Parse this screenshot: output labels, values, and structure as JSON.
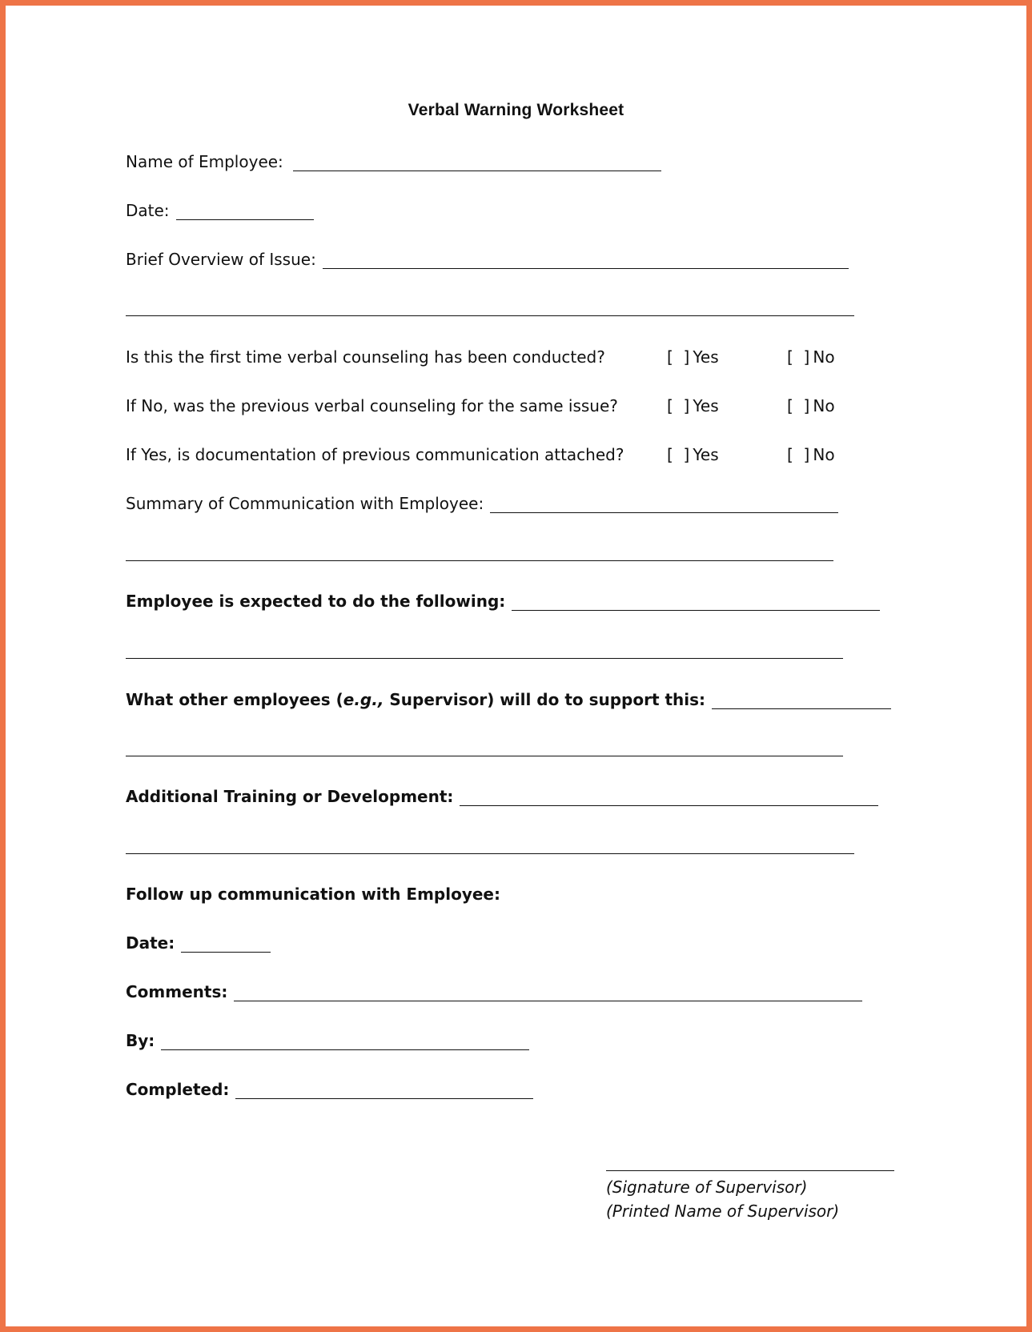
{
  "document": {
    "title": "Verbal Warning Worksheet",
    "frame_color": "#ee7447"
  },
  "fields": {
    "employee_name": {
      "label": "Name of Employee:"
    },
    "date": {
      "label": "Date:"
    },
    "overview": {
      "label": "Brief Overview of Issue:"
    },
    "summary": {
      "label": "Summary of Communication with Employee:"
    },
    "expected": {
      "label": "Employee is expected to do the following:"
    },
    "support": {
      "label_before": "What other employees (",
      "label_italic": "e.g.,",
      "label_after": " Supervisor) will do to support this:"
    },
    "training": {
      "label": "Additional Training or Development:"
    },
    "followup": {
      "heading": "Follow up communication with Employee:"
    },
    "followup_date": {
      "label": "Date:"
    },
    "comments": {
      "label": "Comments:"
    },
    "by": {
      "label": "By:"
    },
    "completed": {
      "label": "Completed:"
    }
  },
  "questions": [
    {
      "text": "Is this the first time verbal counseling has been conducted?",
      "yes_label": "Yes",
      "no_label": "No",
      "yes_checked": false,
      "no_checked": false
    },
    {
      "text": "If No, was the previous verbal counseling for the same issue?",
      "yes_label": "Yes",
      "no_label": "No",
      "yes_checked": false,
      "no_checked": false
    },
    {
      "text": "If Yes, is documentation of previous communication attached?",
      "yes_label": "Yes",
      "no_label": "No",
      "yes_checked": false,
      "no_checked": false
    }
  ],
  "checkbox": {
    "open": "[",
    "close": "]"
  },
  "signature": {
    "signature_label": "(Signature of Supervisor)",
    "printed_name_label": "(Printed Name of Supervisor)"
  }
}
